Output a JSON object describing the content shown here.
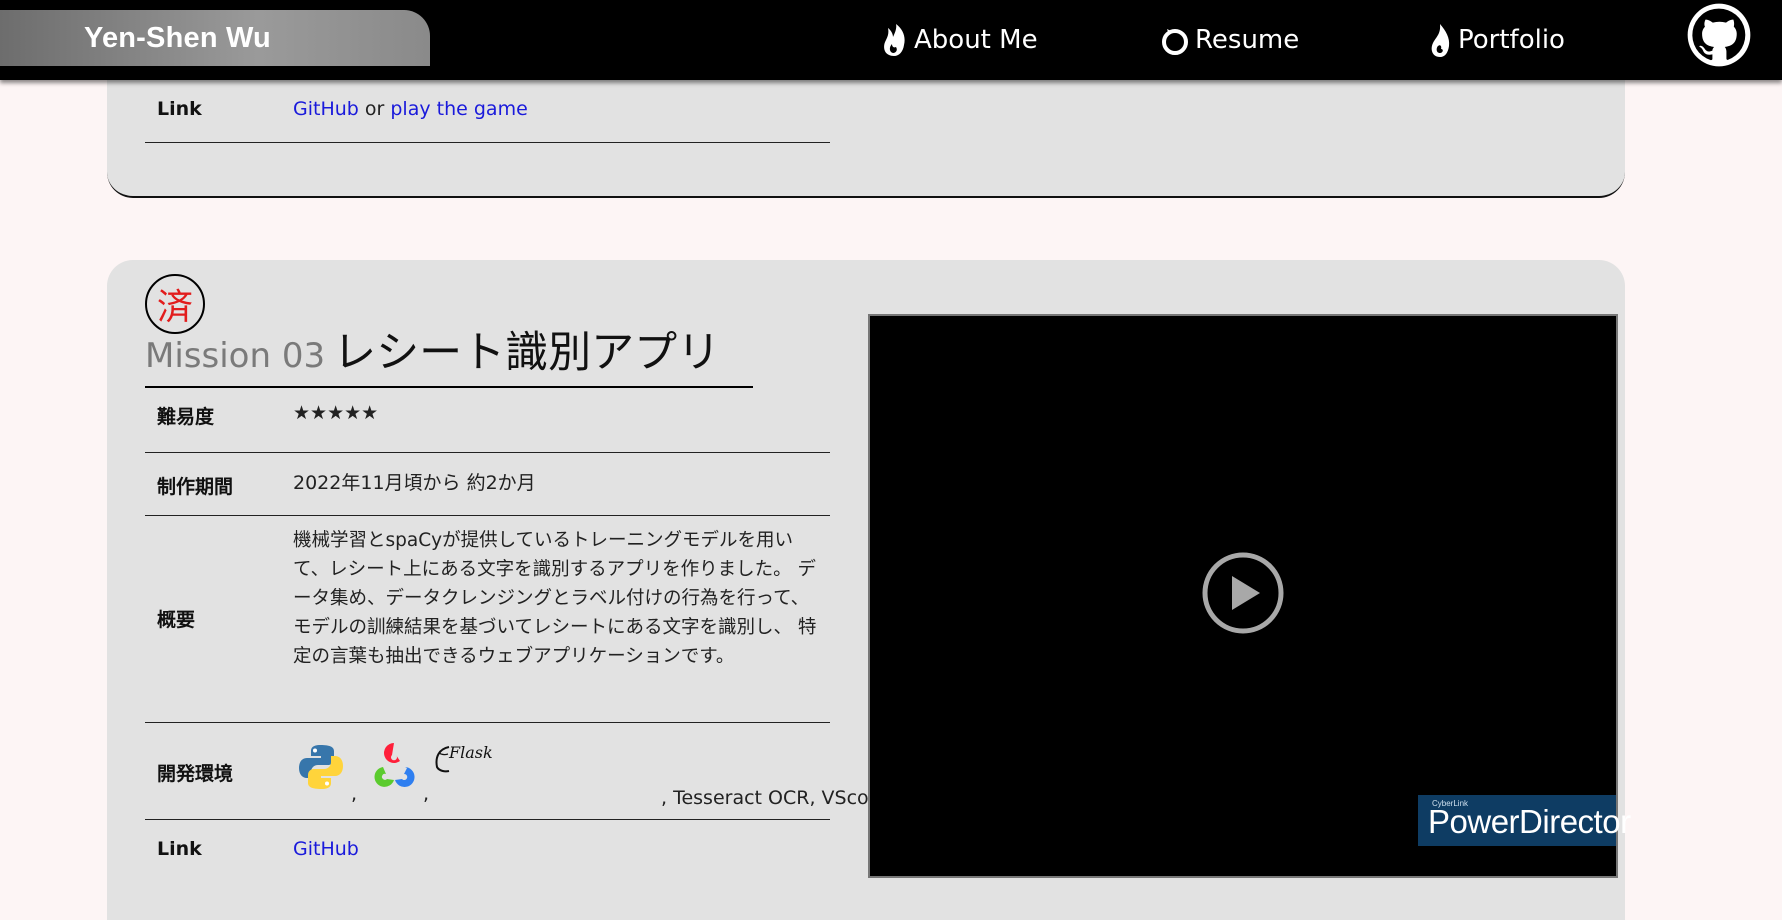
{
  "header": {
    "site_name": "Yen-Shen Wu",
    "nav": [
      {
        "label": "About Me",
        "icon": "flame-icon"
      },
      {
        "label": "Resume",
        "icon": "ouroboros-icon"
      },
      {
        "label": "Portfolio",
        "icon": "droplet-flame-icon"
      }
    ],
    "github_icon": "github-icon"
  },
  "previous_card": {
    "link_label": "Link",
    "link_github": "GitHub",
    "link_or": "or",
    "link_play": "play the game"
  },
  "mission": {
    "stamp": "済",
    "number": "Mission 03",
    "name": "レシート識別アプリ",
    "rows": {
      "difficulty": {
        "label": "難易度",
        "value": "★★★★★"
      },
      "period": {
        "label": "制作期間",
        "value": "2022年11月頃から 約2か月"
      },
      "overview": {
        "label": "概要",
        "value": "機械学習とspaCyが提供しているトレーニングモデルを用いて、レシート上にある文字を識別するアプリを作りました。 データ集め、データクレンジングとラベル付けの行為を行って、モデルの訓練結果を基づいてレシートにある文字を識別し、 特定の言葉も抽出できるウェブアプリケーションです。"
      },
      "environment": {
        "label": "開発環境",
        "icons": [
          "python-icon",
          "opencv-icon",
          "flask-icon"
        ],
        "flask_text": "Flask",
        "comma": ",",
        "extra": ", Tesseract OCR, VScode 等"
      },
      "link": {
        "label": "Link",
        "github": "GitHub"
      }
    },
    "video": {
      "watermark_small": "CyberLink",
      "watermark_big": "PowerDirector"
    }
  }
}
